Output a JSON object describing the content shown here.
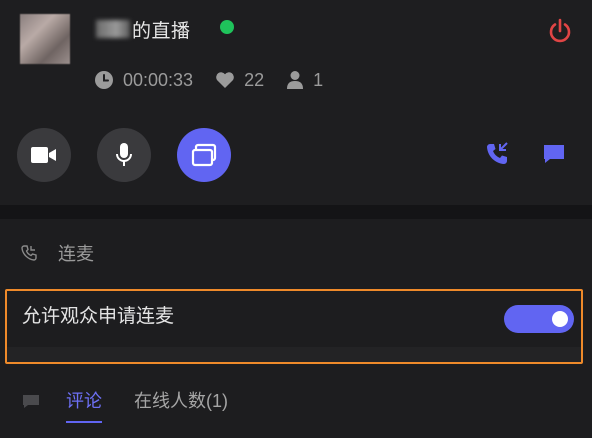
{
  "header": {
    "streamer_name_suffix": "的直播",
    "live_status_color": "#1fc35b",
    "power_icon": "power-icon",
    "power_color": "#e04545"
  },
  "stats": {
    "duration": "00:00:33",
    "likes": "22",
    "viewers": "1",
    "icons": [
      "clock-icon",
      "heart-icon",
      "user-icon"
    ]
  },
  "controls": {
    "buttons": [
      "camera-icon",
      "microphone-icon",
      "screen-share-icon",
      "phone-call-icon",
      "chat-icon"
    ],
    "accent_color": "#6165f2"
  },
  "lianmai": {
    "title": "连麦",
    "allow_label": "允许观众申请连麦",
    "allow_enabled": true,
    "highlight_color": "#ef8a2a"
  },
  "tabs": {
    "items": [
      {
        "label": "评论",
        "active": true
      },
      {
        "label": "在线人数(1)",
        "active": false
      }
    ]
  }
}
